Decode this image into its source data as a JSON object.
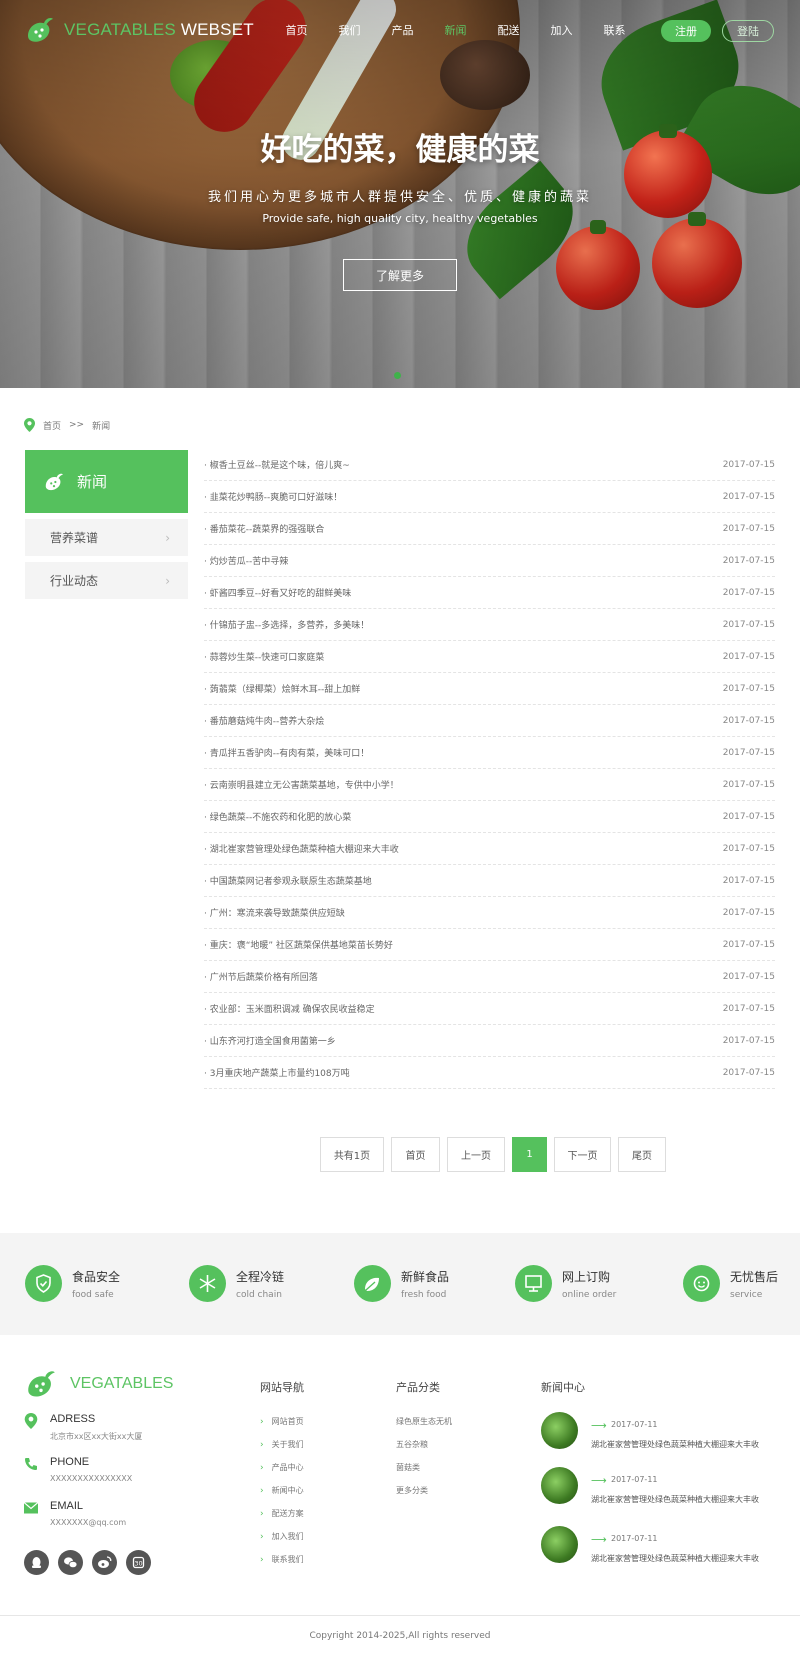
{
  "header": {
    "logo_green": "VEGATABLES",
    "logo_white": "WEBSET",
    "nav": [
      "首页",
      "我们",
      "产品",
      "新闻",
      "配送",
      "加入",
      "联系"
    ],
    "nav_active": "新闻",
    "register": "注册",
    "login": "登陆"
  },
  "hero": {
    "title": "好吃的菜，健康的菜",
    "subtitle": "我们用心为更多城市人群提供安全、优质、健康的蔬菜",
    "subtitle_en": "Provide safe, high quality city, healthy vegetables",
    "button": "了解更多"
  },
  "breadcrumb": {
    "home": "首页",
    "sep": ">>",
    "current": "新闻"
  },
  "sidebar": {
    "title": "新闻",
    "items": [
      "营养菜谱",
      "行业动态"
    ]
  },
  "news": [
    {
      "title": "· 椒香土豆丝--就是这个味，倍儿爽~",
      "date": "2017-07-15"
    },
    {
      "title": "· 韭菜花炒鸭肠--爽脆可口好滋味！",
      "date": "2017-07-15"
    },
    {
      "title": "· 番茄菜花--蔬菜界的强强联合",
      "date": "2017-07-15"
    },
    {
      "title": "· 灼炒苦瓜--苦中寻辣",
      "date": "2017-07-15"
    },
    {
      "title": "· 虾酱四季豆--好看又好吃的甜鲜美味",
      "date": "2017-07-15"
    },
    {
      "title": "· 什锦茄子盅--多选择，多营养，多美味！",
      "date": "2017-07-15"
    },
    {
      "title": "· 蒜蓉炒生菜--快速可口家庭菜",
      "date": "2017-07-15"
    },
    {
      "title": "· 蒟蒻菜（绿椰菜）烩鲜木耳--甜上加鲜",
      "date": "2017-07-15"
    },
    {
      "title": "· 番茄蘑菇炖牛肉--营养大杂烩",
      "date": "2017-07-15"
    },
    {
      "title": "· 青瓜拌五香驴肉--有肉有菜，美味可口！",
      "date": "2017-07-15"
    },
    {
      "title": "· 云南崇明县建立无公害蔬菜基地，专供中小学！",
      "date": "2017-07-15"
    },
    {
      "title": "· 绿色蔬菜--不施农药和化肥的放心菜",
      "date": "2017-07-15"
    },
    {
      "title": "· 湖北崔家营管理处绿色蔬菜种植大棚迎来大丰收",
      "date": "2017-07-15"
    },
    {
      "title": "· 中国蔬菜网记者参观永联原生态蔬菜基地",
      "date": "2017-07-15"
    },
    {
      "title": "· 广州：寒流来袭导致蔬菜供应短缺",
      "date": "2017-07-15"
    },
    {
      "title": "· 重庆：褒“地暖” 社区蔬菜保供基地菜苗长势好",
      "date": "2017-07-15"
    },
    {
      "title": "· 广州节后蔬菜价格有所回落",
      "date": "2017-07-15"
    },
    {
      "title": "· 农业部：玉米面积调减 确保农民收益稳定",
      "date": "2017-07-15"
    },
    {
      "title": "· 山东齐河打造全国食用菌第一乡",
      "date": "2017-07-15"
    },
    {
      "title": "· 3月重庆地产蔬菜上市量约108万吨",
      "date": "2017-07-15"
    }
  ],
  "pager": {
    "total": "共有1页",
    "first": "首页",
    "prev": "上一页",
    "current": "1",
    "next": "下一页",
    "last": "尾页"
  },
  "features": [
    {
      "title": "食品安全",
      "en": "food safe",
      "icon": "shield-icon"
    },
    {
      "title": "全程冷链",
      "en": "cold chain",
      "icon": "snowflake-icon"
    },
    {
      "title": "新鲜食品",
      "en": "fresh food",
      "icon": "leaf-icon"
    },
    {
      "title": "网上订购",
      "en": "online order",
      "icon": "monitor-icon"
    },
    {
      "title": "无忧售后",
      "en": "service",
      "icon": "headset-icon"
    }
  ],
  "footer": {
    "logo": "VEGATABLES",
    "contact": [
      {
        "label": "ADRESS",
        "value": "北京市xx区xx大街xx大厦",
        "icon": "location-icon"
      },
      {
        "label": "PHONE",
        "value": "XXXXXXXXXXXXXXX",
        "icon": "phone-icon"
      },
      {
        "label": "EMAIL",
        "value": "XXXXXXX@qq.com",
        "icon": "mail-icon"
      }
    ],
    "social": [
      "qq-icon",
      "wechat-icon",
      "weibo-icon",
      "renren-icon"
    ],
    "nav_title": "网站导航",
    "nav": [
      "网站首页",
      "关于我们",
      "产品中心",
      "新闻中心",
      "配送方案",
      "加入我们",
      "联系我们"
    ],
    "cat_title": "产品分类",
    "cats": [
      "绿色原生态无机",
      "五谷杂粮",
      "菌菇类",
      "更多分类"
    ],
    "news_title": "新闻中心",
    "news": [
      {
        "date": "2017-07-11",
        "title": "湖北崔家营管理处绿色蔬菜种植大棚迎来大丰收"
      },
      {
        "date": "2017-07-11",
        "title": "湖北崔家营管理处绿色蔬菜种植大棚迎来大丰收"
      },
      {
        "date": "2017-07-11",
        "title": "湖北崔家营管理处绿色蔬菜种植大棚迎来大丰收"
      }
    ],
    "copyright": "Copyright  2014-2025,All rights reserved"
  },
  "colors": {
    "accent": "#55c15d",
    "text": "#555555",
    "feature_bg": "#f4f4f4"
  }
}
